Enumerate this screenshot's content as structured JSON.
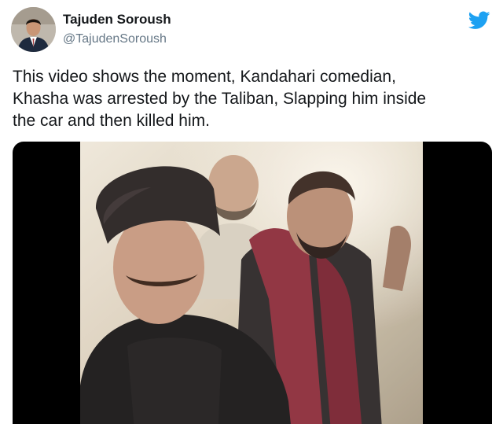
{
  "tweet": {
    "author": {
      "display_name": "Tajuden Soroush",
      "handle": "@TajudenSoroush",
      "avatar_icon": "profile-photo"
    },
    "platform_icon": "twitter-bird-icon",
    "brand_color": "#1da1f2",
    "text": "This video shows the moment, Kandahari comedian,\nKhasha was arrested by the Taliban, Slapping him inside\nthe car and then killed him.",
    "media": {
      "type": "video-still"
    }
  }
}
